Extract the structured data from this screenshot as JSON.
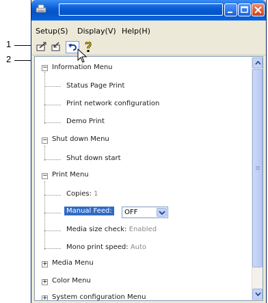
{
  "callouts": [
    "1",
    "2"
  ],
  "window": {
    "title": ""
  },
  "menubar": [
    "Setup(S)",
    "Display(V)",
    "Help(H)"
  ],
  "toolbar": {
    "icons": [
      "open-setting-icon",
      "save-setting-icon",
      "undo-icon",
      "help-icon"
    ]
  },
  "tree": {
    "information_menu": {
      "label": "Information Menu",
      "items": [
        "Status Page Print",
        "Print network configuration",
        "Demo Print"
      ]
    },
    "shut_down_menu": {
      "label": "Shut down Menu",
      "items": [
        "Shut down start"
      ]
    },
    "print_menu": {
      "label": "Print Menu",
      "copies_label": "Copies:",
      "copies_value": "1",
      "manual_feed_label": "Manual Feed:",
      "manual_feed_value": "OFF",
      "media_size_label": "Media size check:",
      "media_size_value": "Enabled",
      "mono_speed_label": "Mono print speed:",
      "mono_speed_value": "Auto"
    },
    "media_menu": {
      "label": "Media Menu"
    },
    "color_menu": {
      "label": "Color Menu"
    },
    "system_config_menu": {
      "label": "System configuration Menu"
    }
  },
  "colors": {
    "selection": "#316ac5",
    "titlebar": "#0a5fd8",
    "value_text": "#8a8a8a"
  }
}
